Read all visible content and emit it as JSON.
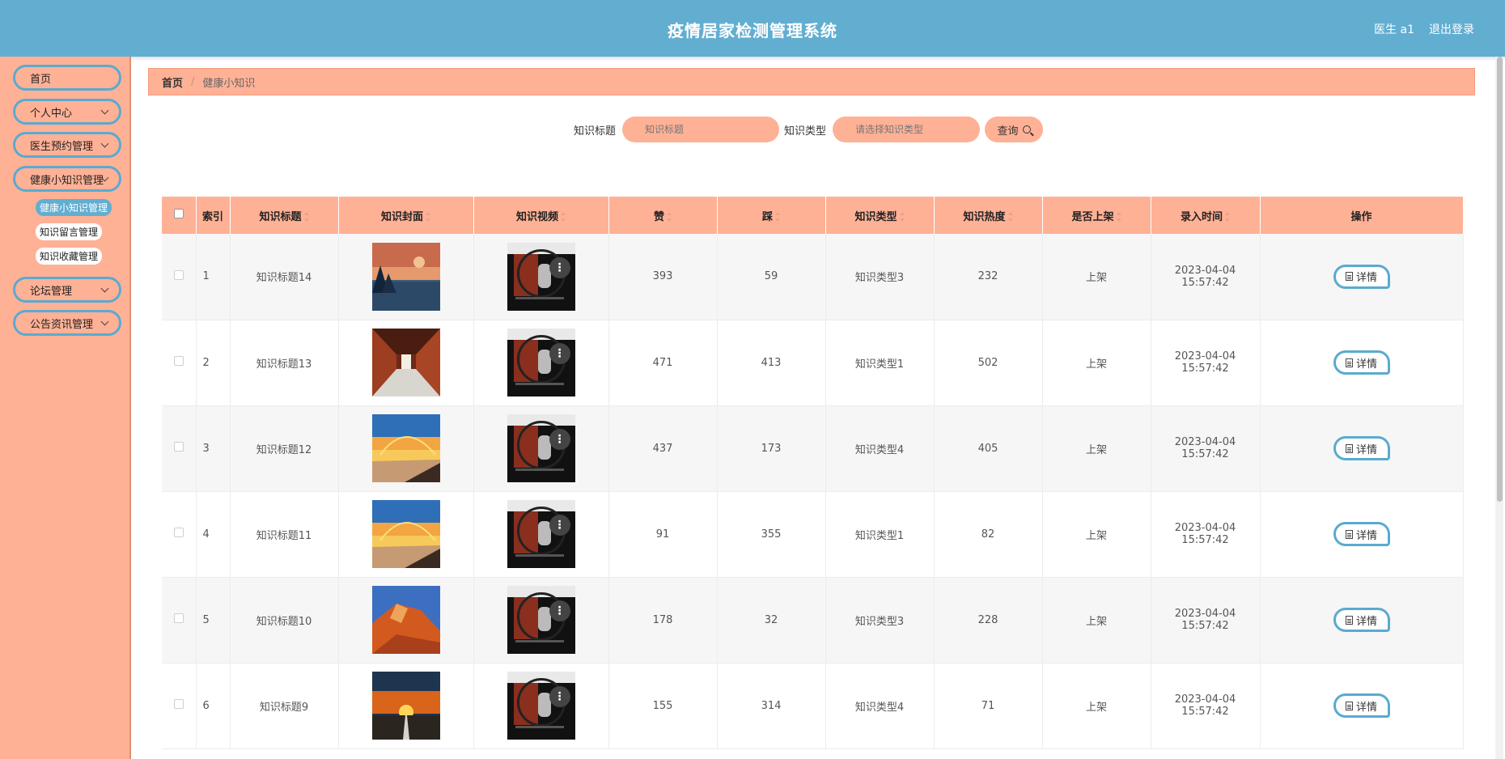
{
  "header": {
    "title": "疫情居家检测管理系统",
    "user": "医生 a1",
    "logout": "退出登录"
  },
  "sidebar": {
    "items": [
      {
        "label": "首页",
        "has_chevron": false
      },
      {
        "label": "个人中心",
        "has_chevron": true
      },
      {
        "label": "医生预约管理",
        "has_chevron": true
      },
      {
        "label": "健康小知识管理",
        "has_chevron": true
      },
      {
        "label": "论坛管理",
        "has_chevron": true
      },
      {
        "label": "公告资讯管理",
        "has_chevron": true
      }
    ],
    "submenu": [
      "健康小知识管理",
      "知识留言管理",
      "知识收藏管理"
    ]
  },
  "breadcrumb": {
    "home": "首页",
    "separator": "/",
    "current": "健康小知识"
  },
  "search": {
    "title_label": "知识标题",
    "title_placeholder": "知识标题",
    "type_label": "知识类型",
    "type_placeholder": "请选择知识类型",
    "button": "查询"
  },
  "table": {
    "headers": [
      "索引",
      "知识标题",
      "知识封面",
      "知识视频",
      "赞",
      "踩",
      "知识类型",
      "知识热度",
      "是否上架",
      "录入时间",
      "操作"
    ],
    "rows": [
      {
        "index": "1",
        "title": "知识标题14",
        "likes": "393",
        "dislikes": "59",
        "type": "知识类型3",
        "heat": "232",
        "status": "上架",
        "time": "2023-04-04 15:57:42",
        "action": "详情",
        "cover": "sunset-lake"
      },
      {
        "index": "2",
        "title": "知识标题13",
        "likes": "471",
        "dislikes": "413",
        "type": "知识类型1",
        "heat": "502",
        "status": "上架",
        "time": "2023-04-04 15:57:42",
        "action": "详情",
        "cover": "corridor"
      },
      {
        "index": "3",
        "title": "知识标题12",
        "likes": "437",
        "dislikes": "173",
        "type": "知识类型4",
        "heat": "405",
        "status": "上架",
        "time": "2023-04-04 15:57:42",
        "action": "详情",
        "cover": "beach-rainbow"
      },
      {
        "index": "4",
        "title": "知识标题11",
        "likes": "91",
        "dislikes": "355",
        "type": "知识类型1",
        "heat": "82",
        "status": "上架",
        "time": "2023-04-04 15:57:42",
        "action": "详情",
        "cover": "beach-rainbow"
      },
      {
        "index": "5",
        "title": "知识标题10",
        "likes": "178",
        "dislikes": "32",
        "type": "知识类型3",
        "heat": "228",
        "status": "上架",
        "time": "2023-04-04 15:57:42",
        "action": "详情",
        "cover": "red-mountain"
      },
      {
        "index": "6",
        "title": "知识标题9",
        "likes": "155",
        "dislikes": "314",
        "type": "知识类型4",
        "heat": "71",
        "status": "上架",
        "time": "2023-04-04 15:57:42",
        "action": "详情",
        "cover": "road-sunset"
      }
    ]
  },
  "colors": {
    "header": "#62aed1",
    "accent": "#ffb196",
    "border_blue": "#5aaad0"
  }
}
